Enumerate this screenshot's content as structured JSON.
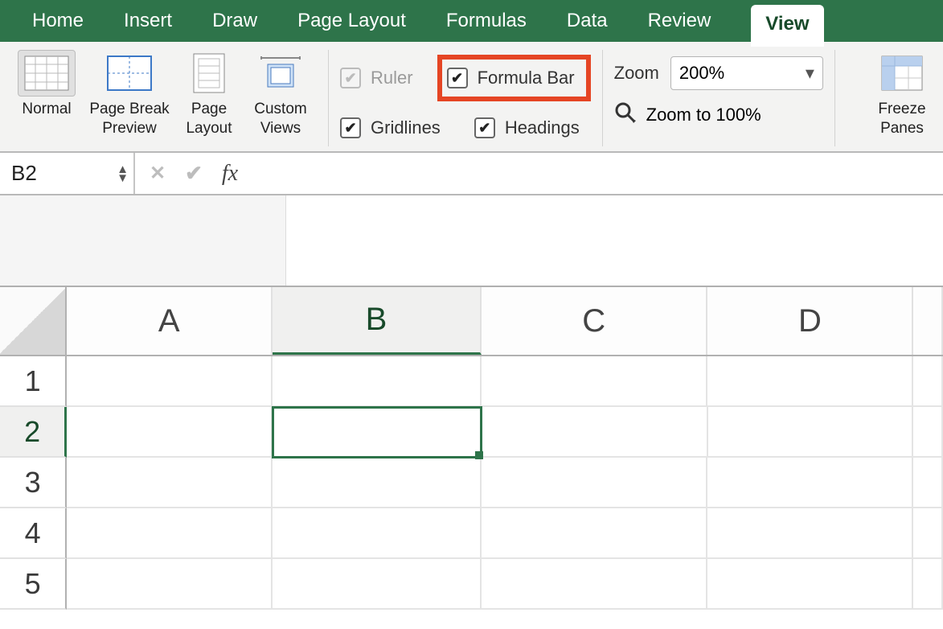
{
  "tabs": {
    "items": [
      "Home",
      "Insert",
      "Draw",
      "Page Layout",
      "Formulas",
      "Data",
      "Review",
      "View"
    ],
    "active": "View"
  },
  "ribbon": {
    "views": {
      "normal": "Normal",
      "page_break": "Page Break Preview",
      "page_layout": "Page Layout",
      "custom_views": "Custom Views"
    },
    "show": {
      "ruler": {
        "label": "Ruler",
        "checked": true,
        "enabled": false
      },
      "formula_bar": {
        "label": "Formula Bar",
        "checked": true,
        "enabled": true
      },
      "gridlines": {
        "label": "Gridlines",
        "checked": true,
        "enabled": true
      },
      "headings": {
        "label": "Headings",
        "checked": true,
        "enabled": true
      }
    },
    "zoom": {
      "label": "Zoom",
      "value": "200%",
      "to100_label": "Zoom to 100%"
    },
    "freeze": {
      "label": "Freeze Panes"
    }
  },
  "formula_bar": {
    "namebox": "B2",
    "fx": "fx",
    "formula": ""
  },
  "grid": {
    "columns": [
      "A",
      "B",
      "C",
      "D"
    ],
    "rows": [
      "1",
      "2",
      "3",
      "4",
      "5"
    ],
    "selected_col": "B",
    "selected_row": "2",
    "selected_cell": "B2"
  }
}
